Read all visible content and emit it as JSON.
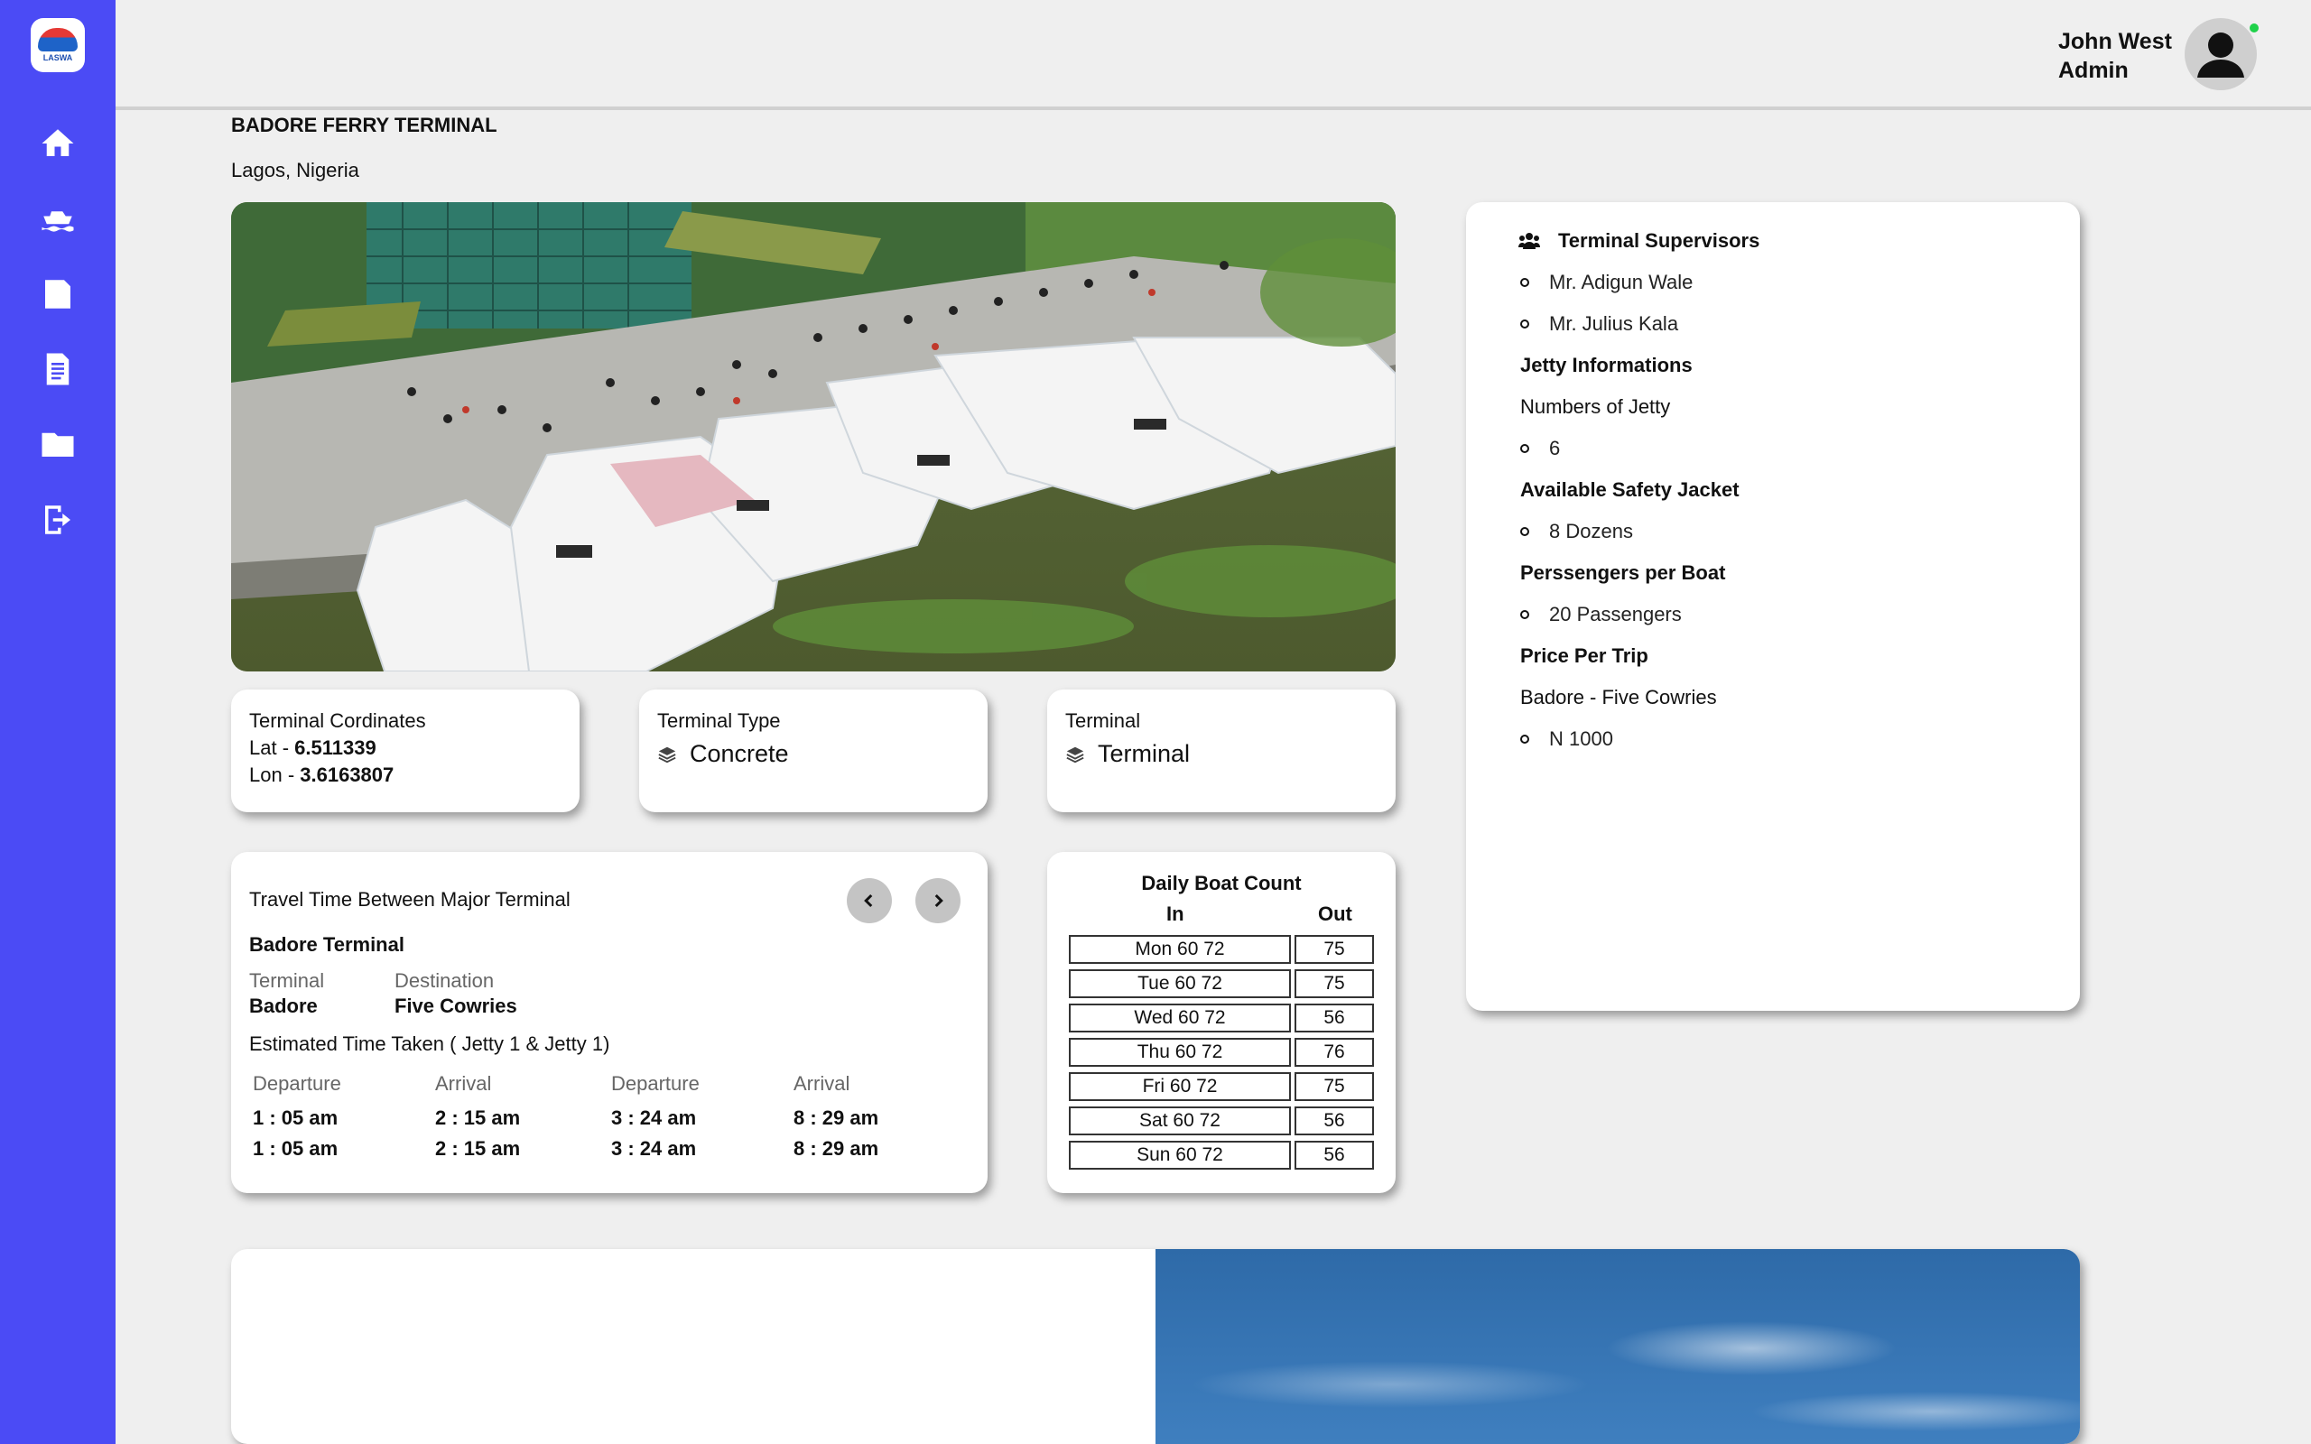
{
  "app": {
    "logo_text": "LASWA"
  },
  "sidebar": {
    "items": [
      {
        "icon": "home-icon"
      },
      {
        "icon": "ferry-icon"
      },
      {
        "icon": "ticket-icon"
      },
      {
        "icon": "document-icon"
      },
      {
        "icon": "folder-icon"
      },
      {
        "icon": "logout-icon"
      }
    ]
  },
  "user": {
    "name": "John West",
    "role": "Admin",
    "status_color": "#1fd14a"
  },
  "terminal": {
    "title": "BADORE FERRY TERMINAL",
    "location": "Lagos, Nigeria"
  },
  "coordinates": {
    "label": "Terminal Cordinates",
    "lat_label": "Lat - ",
    "lat": "6.511339",
    "lon_label": "Lon - ",
    "lon": "3.6163807"
  },
  "terminal_type": {
    "label": "Terminal Type",
    "value": "Concrete",
    "icon": "layers-icon"
  },
  "terminal_card": {
    "label": "Terminal",
    "value": "Terminal",
    "icon": "layers-icon"
  },
  "travel_time": {
    "title": "Travel Time Between Major Terminal",
    "terminal_name": "Badore Terminal",
    "terminal_label": "Terminal",
    "terminal_value": "Badore",
    "destination_label": "Destination",
    "destination_value": "Five Cowries",
    "estimate_label": "Estimated Time Taken ( Jetty 1 & Jetty 1)",
    "headers": [
      "Departure",
      "Arrival",
      "Departure",
      "Arrival"
    ],
    "rows": [
      [
        "1 : 05 am",
        "2 : 15 am",
        "3 : 24 am",
        "8 : 29 am"
      ],
      [
        "1 : 05 am",
        "2 : 15 am",
        "3 : 24 am",
        "8 : 29 am"
      ]
    ]
  },
  "boat_count": {
    "title": "Daily Boat Count",
    "col_in": "In",
    "col_out": "Out",
    "rows": [
      {
        "day": "Mon 60 72",
        "out": "75"
      },
      {
        "day": "Tue 60 72",
        "out": "75"
      },
      {
        "day": "Wed 60 72",
        "out": "56"
      },
      {
        "day": "Thu 60 72",
        "out": "76"
      },
      {
        "day": "Fri 60 72",
        "out": "75"
      },
      {
        "day": "Sat 60 72",
        "out": "56"
      },
      {
        "day": "Sun 60 72",
        "out": "56"
      }
    ]
  },
  "info": {
    "supervisors_title": "Terminal Supervisors",
    "supervisors": [
      "Mr. Adigun Wale",
      "Mr. Julius Kala"
    ],
    "jetty_title": "Jetty Informations",
    "jetty_sub": "Numbers of Jetty",
    "jetty_count": "6",
    "safety_title": "Available Safety Jacket",
    "safety_value": "8 Dozens",
    "passengers_title": "Perssengers per Boat",
    "passengers_value": "20 Passengers",
    "price_title": "Price Per Trip",
    "price_route": "Badore - Five Cowries",
    "price_value": "N 1000"
  }
}
